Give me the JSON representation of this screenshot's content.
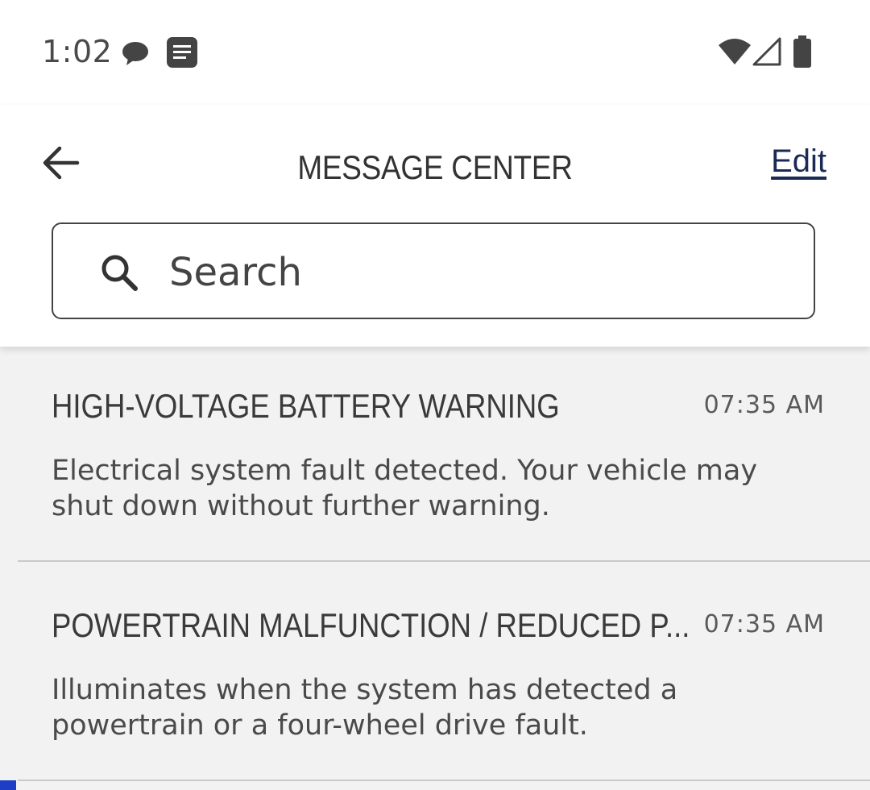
{
  "status_bar": {
    "time": "1:02",
    "icons": [
      "chat-bubble-icon",
      "message-icon",
      "wifi-icon",
      "cell-signal-icon",
      "battery-icon"
    ]
  },
  "header": {
    "title": "MESSAGE CENTER",
    "edit_label": "Edit",
    "back_icon": "arrow-left-icon"
  },
  "search": {
    "placeholder": "Search",
    "value": ""
  },
  "messages": [
    {
      "title": "HIGH-VOLTAGE BATTERY WARNING",
      "time": "07:35 AM",
      "body": "Electrical system fault detected. Your vehicle may shut down without further warning."
    },
    {
      "title": "POWERTRAIN MALFUNCTION / REDUCED P...",
      "time": "07:35 AM",
      "body": "Illuminates when the system has detected a powertrain or a four-wheel drive fault."
    }
  ],
  "colors": {
    "link": "#1a2a55",
    "list_background": "#f2f2f2",
    "accent_marker": "#1f3ec6"
  }
}
